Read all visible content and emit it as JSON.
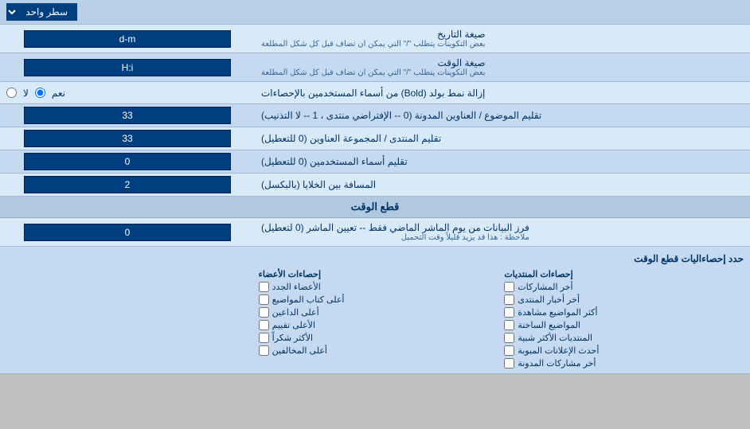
{
  "page": {
    "dropdown_label": "سطر واحد",
    "sections": [
      {
        "id": "date_format",
        "label": "صيغة التاريخ",
        "note": "بعض التكوينات يتطلب \"/\" التي يمكن ان تضاف قبل كل شكل المطلعة",
        "value": "d-m"
      },
      {
        "id": "time_format",
        "label": "صيغة الوقت",
        "note": "بعض التكوينات يتطلب \"/\" التي يمكن ان تضاف قبل كل شكل المطلعة",
        "value": "H:i"
      },
      {
        "id": "bold_remove",
        "label": "إزالة نمط بولد (Bold) من أسماء المستخدمين بالإحصاءات",
        "type": "radio",
        "options": [
          {
            "label": "نعم",
            "value": "yes"
          },
          {
            "label": "لا",
            "value": "no"
          }
        ],
        "selected": "yes"
      },
      {
        "id": "topic_subject",
        "label": "تقليم الموضوع / العناوين المدونة (0 -- الإفتراضي منتدى ، 1 -- لا التذنيب)",
        "value": "33"
      },
      {
        "id": "forum_topic",
        "label": "تقليم المنتدى / المجموعة العناوين (0 للتعطيل)",
        "value": "33"
      },
      {
        "id": "usernames",
        "label": "تقليم أسماء المستخدمين (0 للتعطيل)",
        "value": "0"
      },
      {
        "id": "cell_spacing",
        "label": "المسافة بين الخلايا (بالبكسل)",
        "value": "2"
      }
    ],
    "realtime_section": {
      "header": "قطع الوقت",
      "field": {
        "label": "فرز البيانات من يوم الماشر الماضي فقط -- تعيين الماشر (0 لتعطيل)",
        "note": "ملاحظة : هذا قد يزيد قليلاً وقت التحميل",
        "value": "0"
      },
      "stats_title": "حدد إحصاءاليات قطع الوقت"
    },
    "checkboxes": {
      "col1_title": "إحصاءات المنتديات",
      "col1": [
        "أخر المشاركات",
        "أخر أخبار المنتدى",
        "أكثر المواضيع مشاهدة",
        "المواضيع الساخنة",
        "المنتديات الأكثر شبية",
        "أحدث الإعلانات المبوبة",
        "أخر مشاركات المدونة"
      ],
      "col2_title": "إحصاءات الأعضاء",
      "col2": [
        "الأعضاء الجدد",
        "أعلى كتاب المواضيع",
        "أعلى الداعين",
        "الأعلى تقييم",
        "الأكثر شكراً",
        "أعلى المخالفين"
      ]
    }
  }
}
